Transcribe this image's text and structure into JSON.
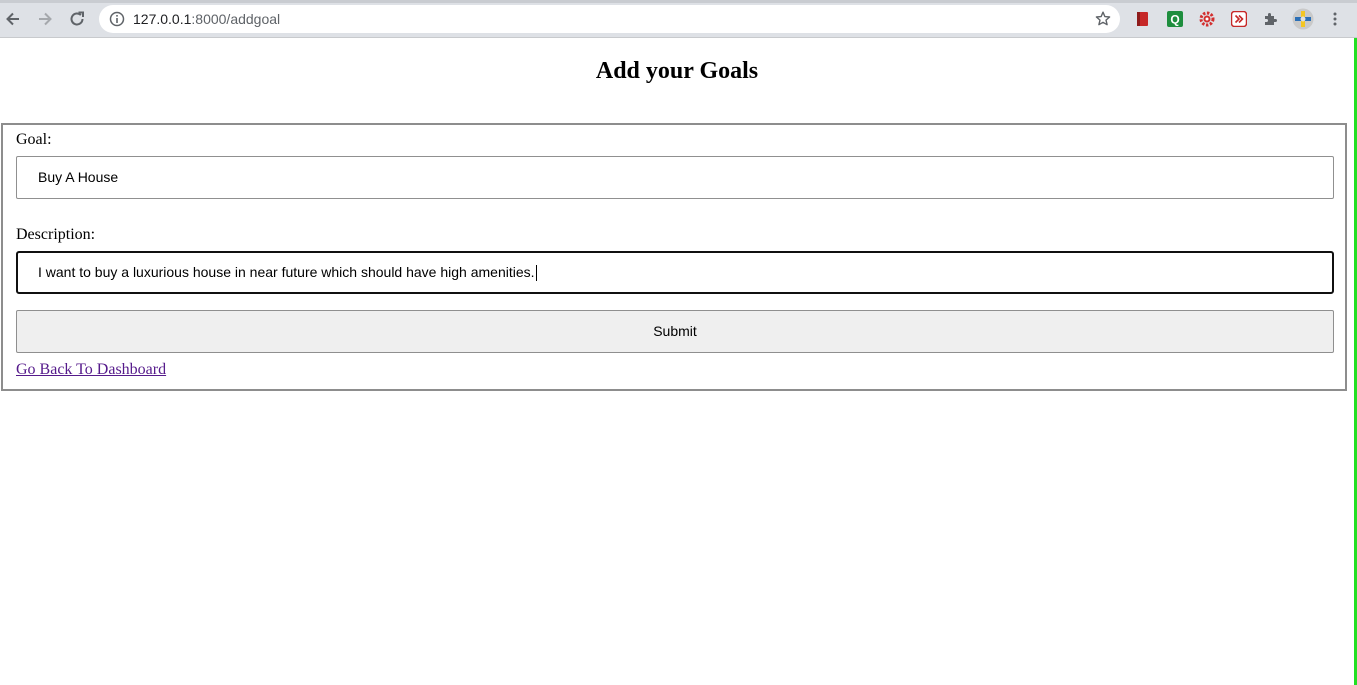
{
  "browser": {
    "url_host": "127.0.0.1",
    "url_path": ":8000/addgoal"
  },
  "page": {
    "title": "Add your Goals"
  },
  "form": {
    "goal_label": "Goal:",
    "goal_value": "Buy A House",
    "description_label": "Description:",
    "description_value": "I want to buy a luxurious house in near future which should have high amenities.",
    "submit_label": "Submit",
    "back_link": "Go Back To Dashboard"
  },
  "colors": {
    "link_visited": "#551a8b",
    "button_bg": "#efefef",
    "window_edge": "#22e022"
  },
  "icons": [
    "back-arrow-icon",
    "forward-arrow-icon",
    "reload-icon",
    "info-icon",
    "bookmark-star-icon",
    "red-book-extension-icon",
    "q-extension-icon",
    "red-gear-extension-icon",
    "red-play-extension-icon",
    "puzzle-extensions-icon",
    "profile-avatar-icon",
    "kebab-menu-icon"
  ]
}
